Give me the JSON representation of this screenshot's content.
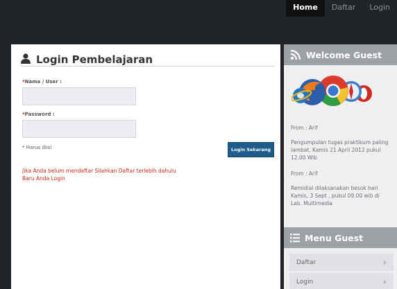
{
  "nav": {
    "items": [
      {
        "label": "Home",
        "active": true
      },
      {
        "label": "Daftar",
        "active": false
      },
      {
        "label": "Login",
        "active": false
      }
    ]
  },
  "login_panel": {
    "title": "Login Pembelajaran",
    "icon": "user-icon",
    "username_label": "Nama / User :",
    "username_value": "",
    "password_label": "Password :",
    "password_value": "",
    "required_mark": "*",
    "required_note": "* Harus diisi",
    "submit_label": "Login Sekarang",
    "message_line1": "Jika Anda belum mendaftar Silahkan Daftar terlebih dahulu",
    "message_line2": "Baru Anda Login"
  },
  "welcome": {
    "title": "Welcome Guest",
    "icon": "feed-icon",
    "image": "browser-logos",
    "messages": [
      {
        "from": "From : Arif",
        "text": "Pengumpulan tugas praktikum paling lambat, Kamis 21 April 2012 pukul 12.00 Wib"
      },
      {
        "from": "From : Arif",
        "text": "Remidial dilaksanakan besok hari Kamis, 3 Sept , pukul 09.00 wib di Lab. Multimedia"
      }
    ]
  },
  "menu_guest": {
    "title": "Menu Guest",
    "icon": "list-icon",
    "items": [
      {
        "label": "Daftar"
      },
      {
        "label": "Login"
      }
    ]
  },
  "colors": {
    "background": "#1f2226",
    "button": "#1f5b8c",
    "message_text": "#cc2a18",
    "sidebar_header": "#9da1a6"
  }
}
